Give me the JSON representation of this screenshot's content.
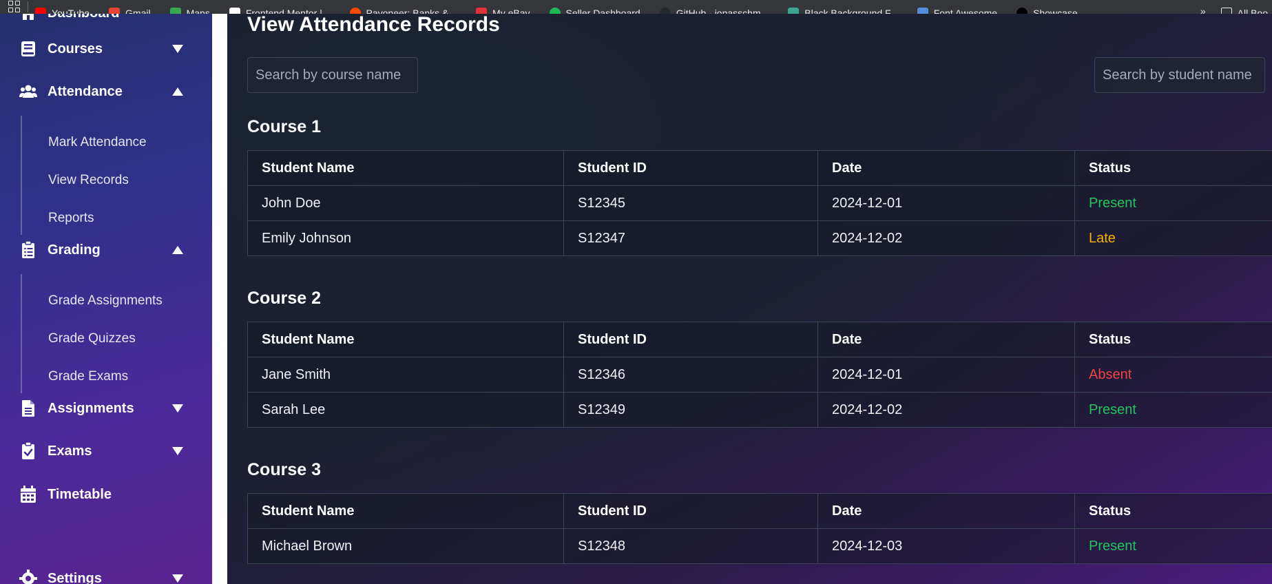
{
  "bookmarks": [
    {
      "label": "YouTube",
      "color": "#ff0000"
    },
    {
      "label": "Gmail",
      "color": "#ea4335"
    },
    {
      "label": "Maps",
      "color": "#34a853"
    },
    {
      "label": "Frontend Mentor |...",
      "color": "#ffffff"
    },
    {
      "label": "Payoneer: Banks &...",
      "color": "#ff4800"
    },
    {
      "label": "My eBay",
      "color": "#e53238"
    },
    {
      "label": "Seller Dashboard",
      "color": "#1db954"
    },
    {
      "label": "GitHub - jonasschm...",
      "color": "#24292e"
    },
    {
      "label": "Black Background F...",
      "color": "#3aa68f"
    },
    {
      "label": "Font Awesome",
      "color": "#538dd7"
    },
    {
      "label": "Showcase",
      "color": "#000000"
    }
  ],
  "bookmarks_more": "»",
  "bookmarks_all": "All Boo",
  "sidebar": {
    "dashboard": "Dashboard",
    "courses": "Courses",
    "attendance": "Attendance",
    "attendance_items": [
      "Mark Attendance",
      "View Records",
      "Reports"
    ],
    "grading": "Grading",
    "grading_items": [
      "Grade Assignments",
      "Grade Quizzes",
      "Grade Exams"
    ],
    "assignments": "Assignments",
    "exams": "Exams",
    "timetable": "Timetable",
    "settings": "Settings"
  },
  "main": {
    "title": "View Attendance Records",
    "search_course_placeholder": "Search by course name",
    "search_student_placeholder": "Search by student name",
    "headers": [
      "Student Name",
      "Student ID",
      "Date",
      "Status"
    ],
    "courses": [
      {
        "name": "Course 1",
        "rows": [
          {
            "name": "John Doe",
            "id": "S12345",
            "date": "2024-12-01",
            "status": "Present"
          },
          {
            "name": "Emily Johnson",
            "id": "S12347",
            "date": "2024-12-02",
            "status": "Late"
          }
        ]
      },
      {
        "name": "Course 2",
        "rows": [
          {
            "name": "Jane Smith",
            "id": "S12346",
            "date": "2024-12-01",
            "status": "Absent"
          },
          {
            "name": "Sarah Lee",
            "id": "S12349",
            "date": "2024-12-02",
            "status": "Present"
          }
        ]
      },
      {
        "name": "Course 3",
        "rows": [
          {
            "name": "Michael Brown",
            "id": "S12348",
            "date": "2024-12-03",
            "status": "Present"
          }
        ]
      }
    ]
  },
  "colors": {
    "present": "#22c55e",
    "late": "#f5b400",
    "absent": "#ef4444"
  }
}
